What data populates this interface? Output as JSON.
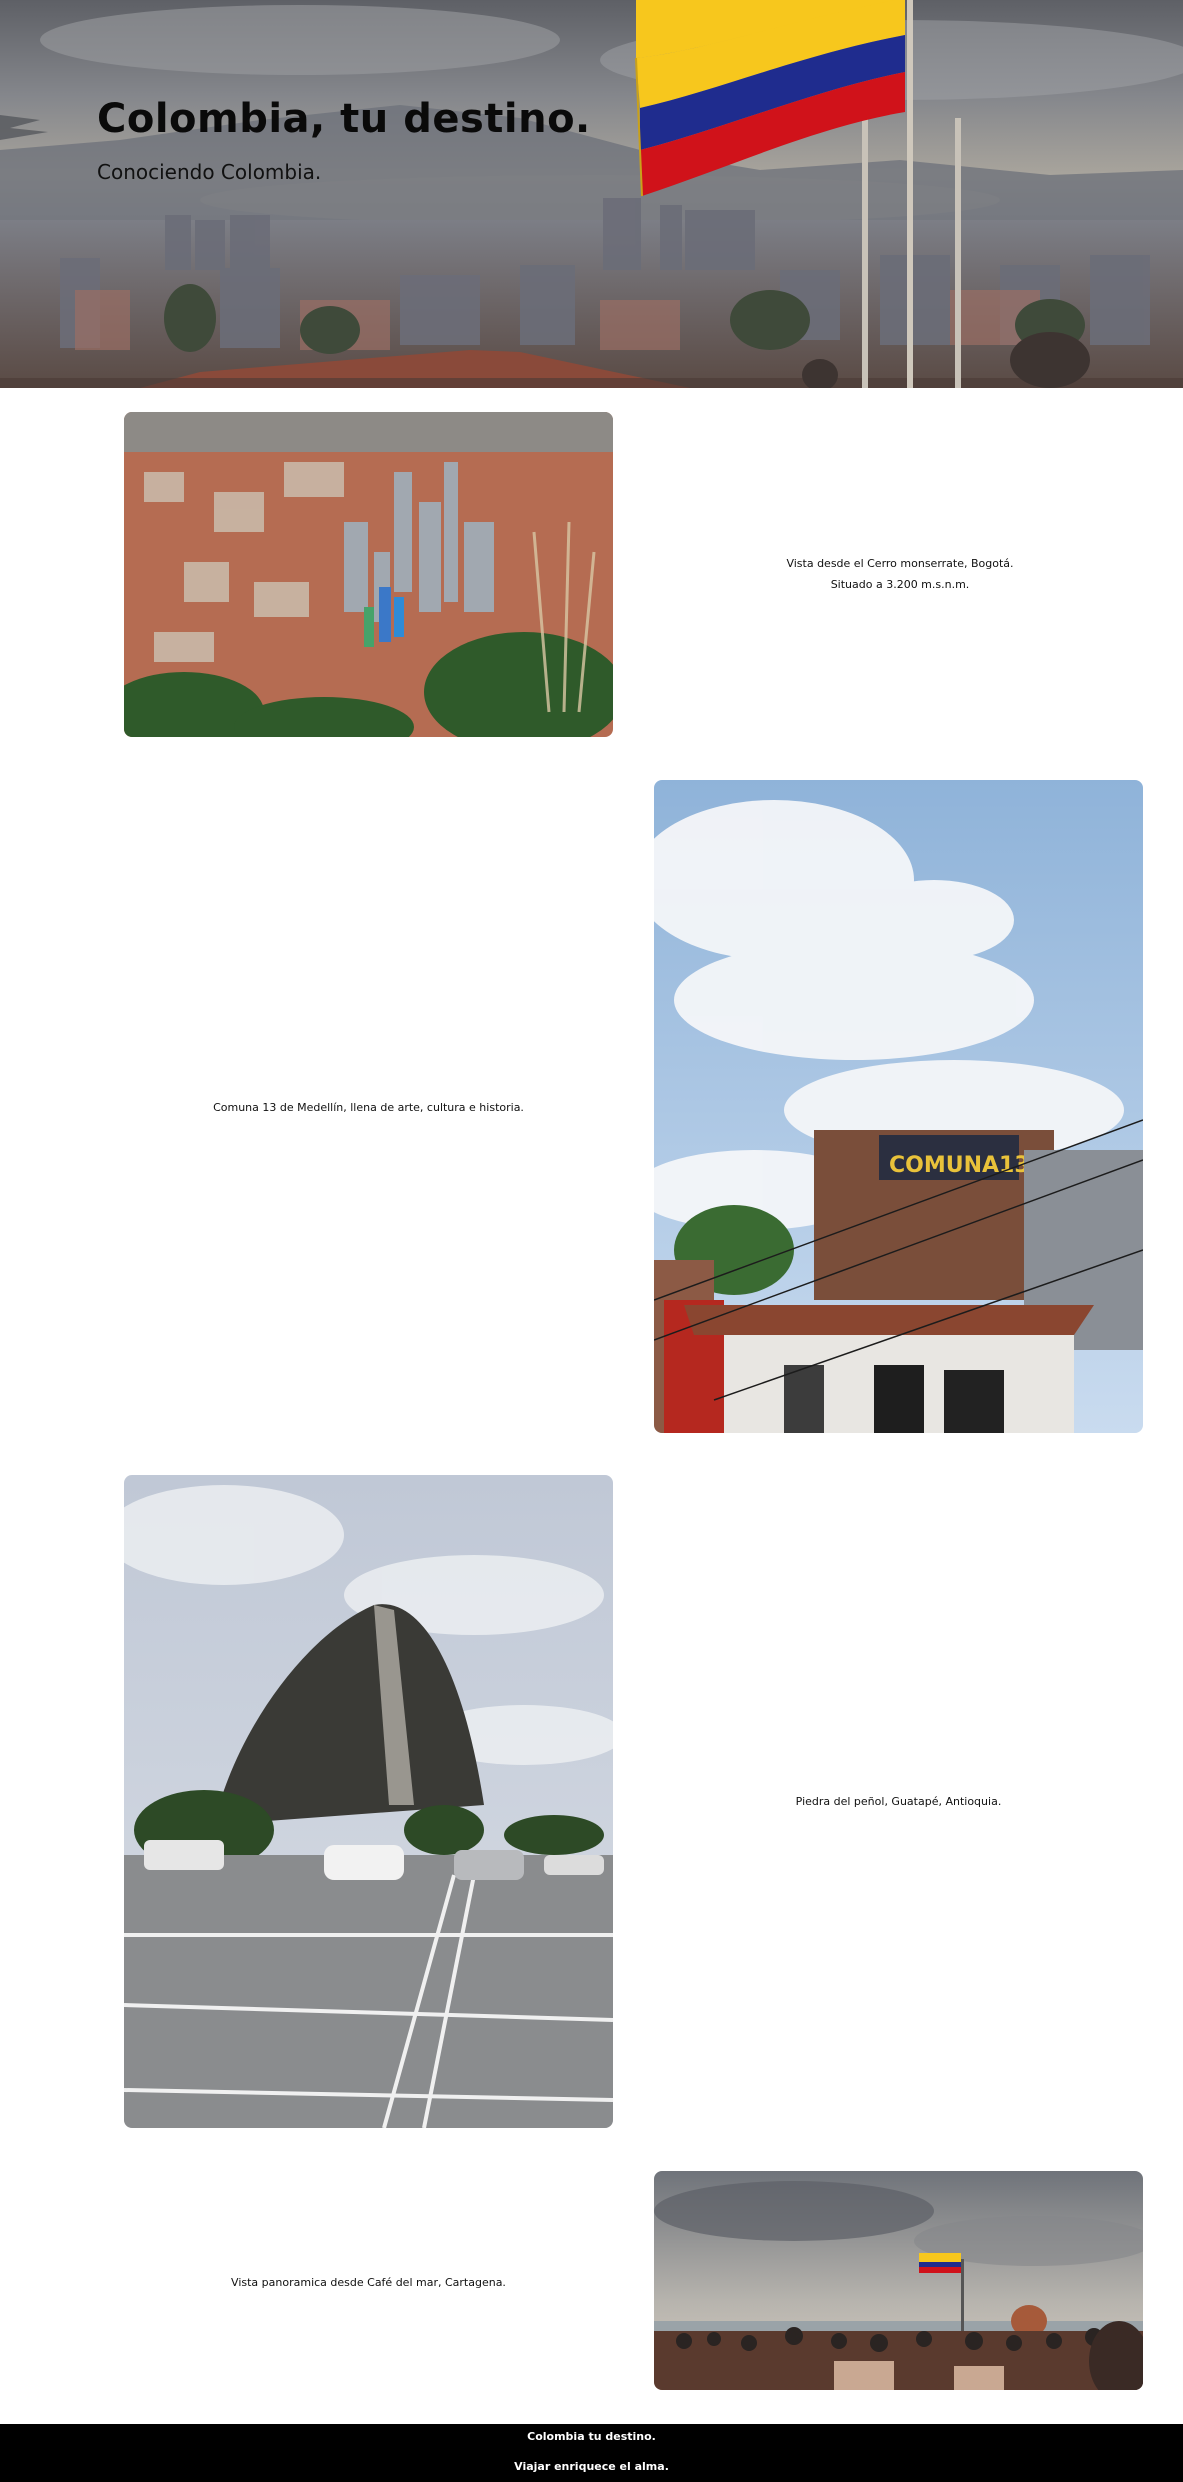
{
  "hero": {
    "title_bold": "Colombia,",
    "title_rest": " tu destino.",
    "subtitle": "Conociendo Colombia."
  },
  "gallery": [
    {
      "image": "bogota-aerial-city-view",
      "caption_lines": [
        "Vista desde el Cerro monserrate, Bogotá.",
        "Situado a 3.200 m.s.n.m."
      ]
    },
    {
      "image": "comuna-13-colorful-houses",
      "sign_text": "COMUNA13",
      "caption_lines": [
        "Comuna 13 de Medellín, llena de arte, cultura e historia."
      ]
    },
    {
      "image": "piedra-del-penol-rock",
      "caption_lines": [
        "Piedra del peñol, Guatapé, Antioquia."
      ]
    },
    {
      "image": "cartagena-cafe-del-mar-panorama",
      "caption_lines": [
        "Vista panoramica desde Café del mar, Cartagena."
      ]
    }
  ],
  "footer": {
    "line1": "Colombia tu destino.",
    "line2": "Viajar enriquece el alma."
  },
  "colors": {
    "flag_yellow": "#f7c71d",
    "flag_blue": "#1f2c8e",
    "flag_red": "#d0121a",
    "footer_bg": "#000000"
  }
}
